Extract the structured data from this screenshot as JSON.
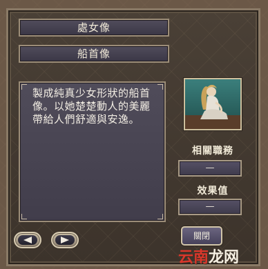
{
  "header": {
    "title": "處女像",
    "subtitle": "船首像"
  },
  "description": "製成純真少女形狀的船首像。以她楚楚動人的美麗帶給人們舒適與安逸。",
  "portrait_icon": "figurehead-maiden-portrait",
  "related_job": {
    "label": "相關職務",
    "value": "—"
  },
  "effect": {
    "label": "效果值",
    "value": "—"
  },
  "nav": {
    "prev_icon": "arrow-left-icon",
    "next_icon": "arrow-right-icon"
  },
  "close_button": {
    "label": "關閉"
  },
  "watermark": {
    "part1": "云南",
    "part2": "龙网"
  },
  "colors": {
    "accent_border": "#9c8d78",
    "panel_bg": "#4a4656",
    "text": "#f1ead8",
    "watermark_red": "#d9372b"
  }
}
